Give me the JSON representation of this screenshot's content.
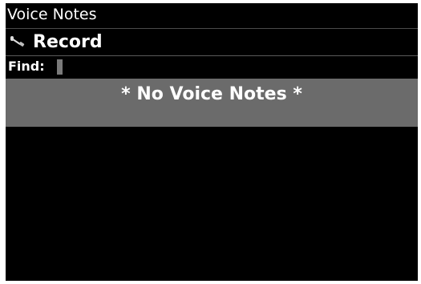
{
  "window": {
    "title": "Voice Notes"
  },
  "toolbar": {
    "record_icon": "microphone-icon",
    "record_label": "Record"
  },
  "search": {
    "label": "Find:",
    "value": ""
  },
  "list": {
    "empty_message": "* No Voice Notes *"
  },
  "colors": {
    "background": "#000000",
    "text": "#ffffff",
    "selection_row": "#6b6b6b",
    "cursor": "#7a7a7a"
  }
}
